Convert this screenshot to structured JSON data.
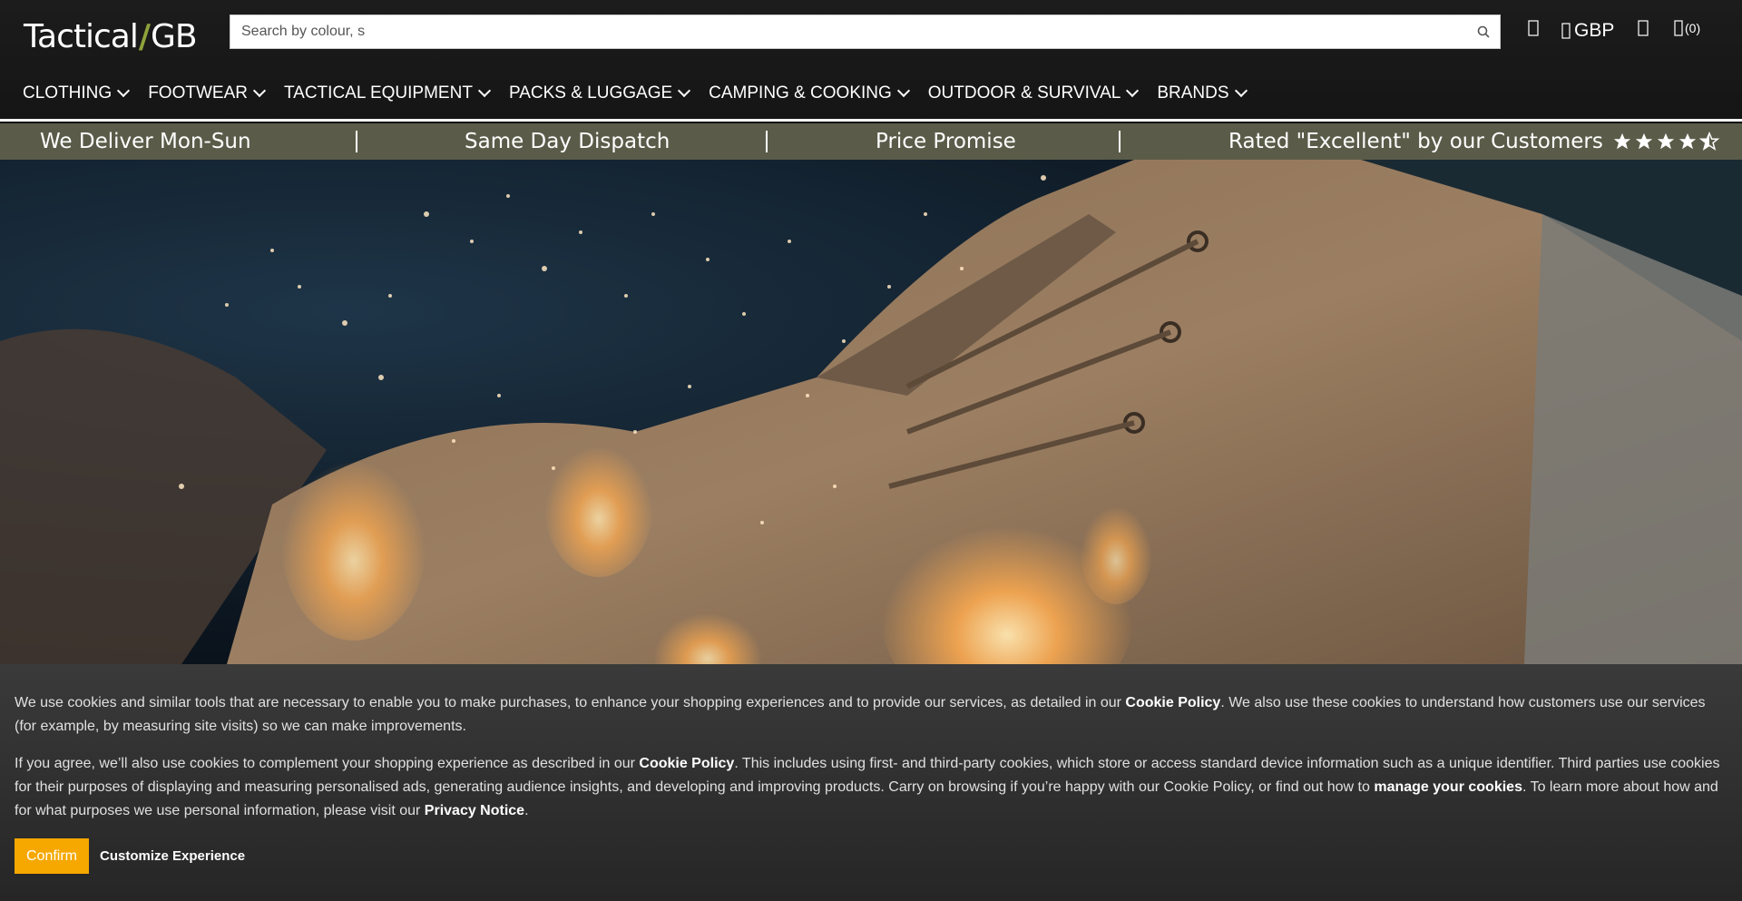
{
  "header": {
    "logo_left": "Tactical",
    "logo_right": "GB",
    "search_placeholder": "Search by colour, s",
    "currency": "GBP",
    "cart_count": "(0)"
  },
  "nav": {
    "items": [
      {
        "label": "CLOTHING"
      },
      {
        "label": "FOOTWEAR"
      },
      {
        "label": "TACTICAL EQUIPMENT"
      },
      {
        "label": "PACKS & LUGGAGE"
      },
      {
        "label": "CAMPING & COOKING"
      },
      {
        "label": "OUTDOOR & SURVIVAL"
      },
      {
        "label": "BRANDS"
      }
    ]
  },
  "usp": {
    "delivery": "We Deliver Mon-Sun",
    "dispatch": "Same Day Dispatch",
    "price": "Price Promise",
    "rating": "Rated \"Excellent\" by our Customers",
    "stars": 4.5
  },
  "cookie": {
    "p1_a": "We use cookies and similar tools that are necessary to enable you to make purchases, to enhance your shopping experiences and to provide our services, as detailed in our ",
    "p1_link": "Cookie Policy",
    "p1_b": ". We also use these cookies to understand how customers use our services (for example, by measuring site visits) so we can make improvements.",
    "p2_a": "If you agree, we’ll also use cookies to complement your shopping experience as described in our ",
    "p2_link1": "Cookie Policy",
    "p2_b": ". This includes using first- and third-party cookies, which store or access standard device information such as a unique identifier. Third parties use cookies for their purposes of displaying and measuring personalised ads, generating audience insights, and developing and improving products. Carry on browsing if you’re happy with our Cookie Policy, or find out how to ",
    "p2_link2": "manage your cookies",
    "p2_c": ". To learn more about how and for what purposes we use personal information, please visit our ",
    "p2_link3": "Privacy Notice",
    "p2_d": ".",
    "confirm": "Confirm",
    "customize": "Customize Experience"
  },
  "colors": {
    "usp_bar": "#5a5c49",
    "confirm": "#f6a800",
    "logo_accent": "#8ea33a"
  }
}
